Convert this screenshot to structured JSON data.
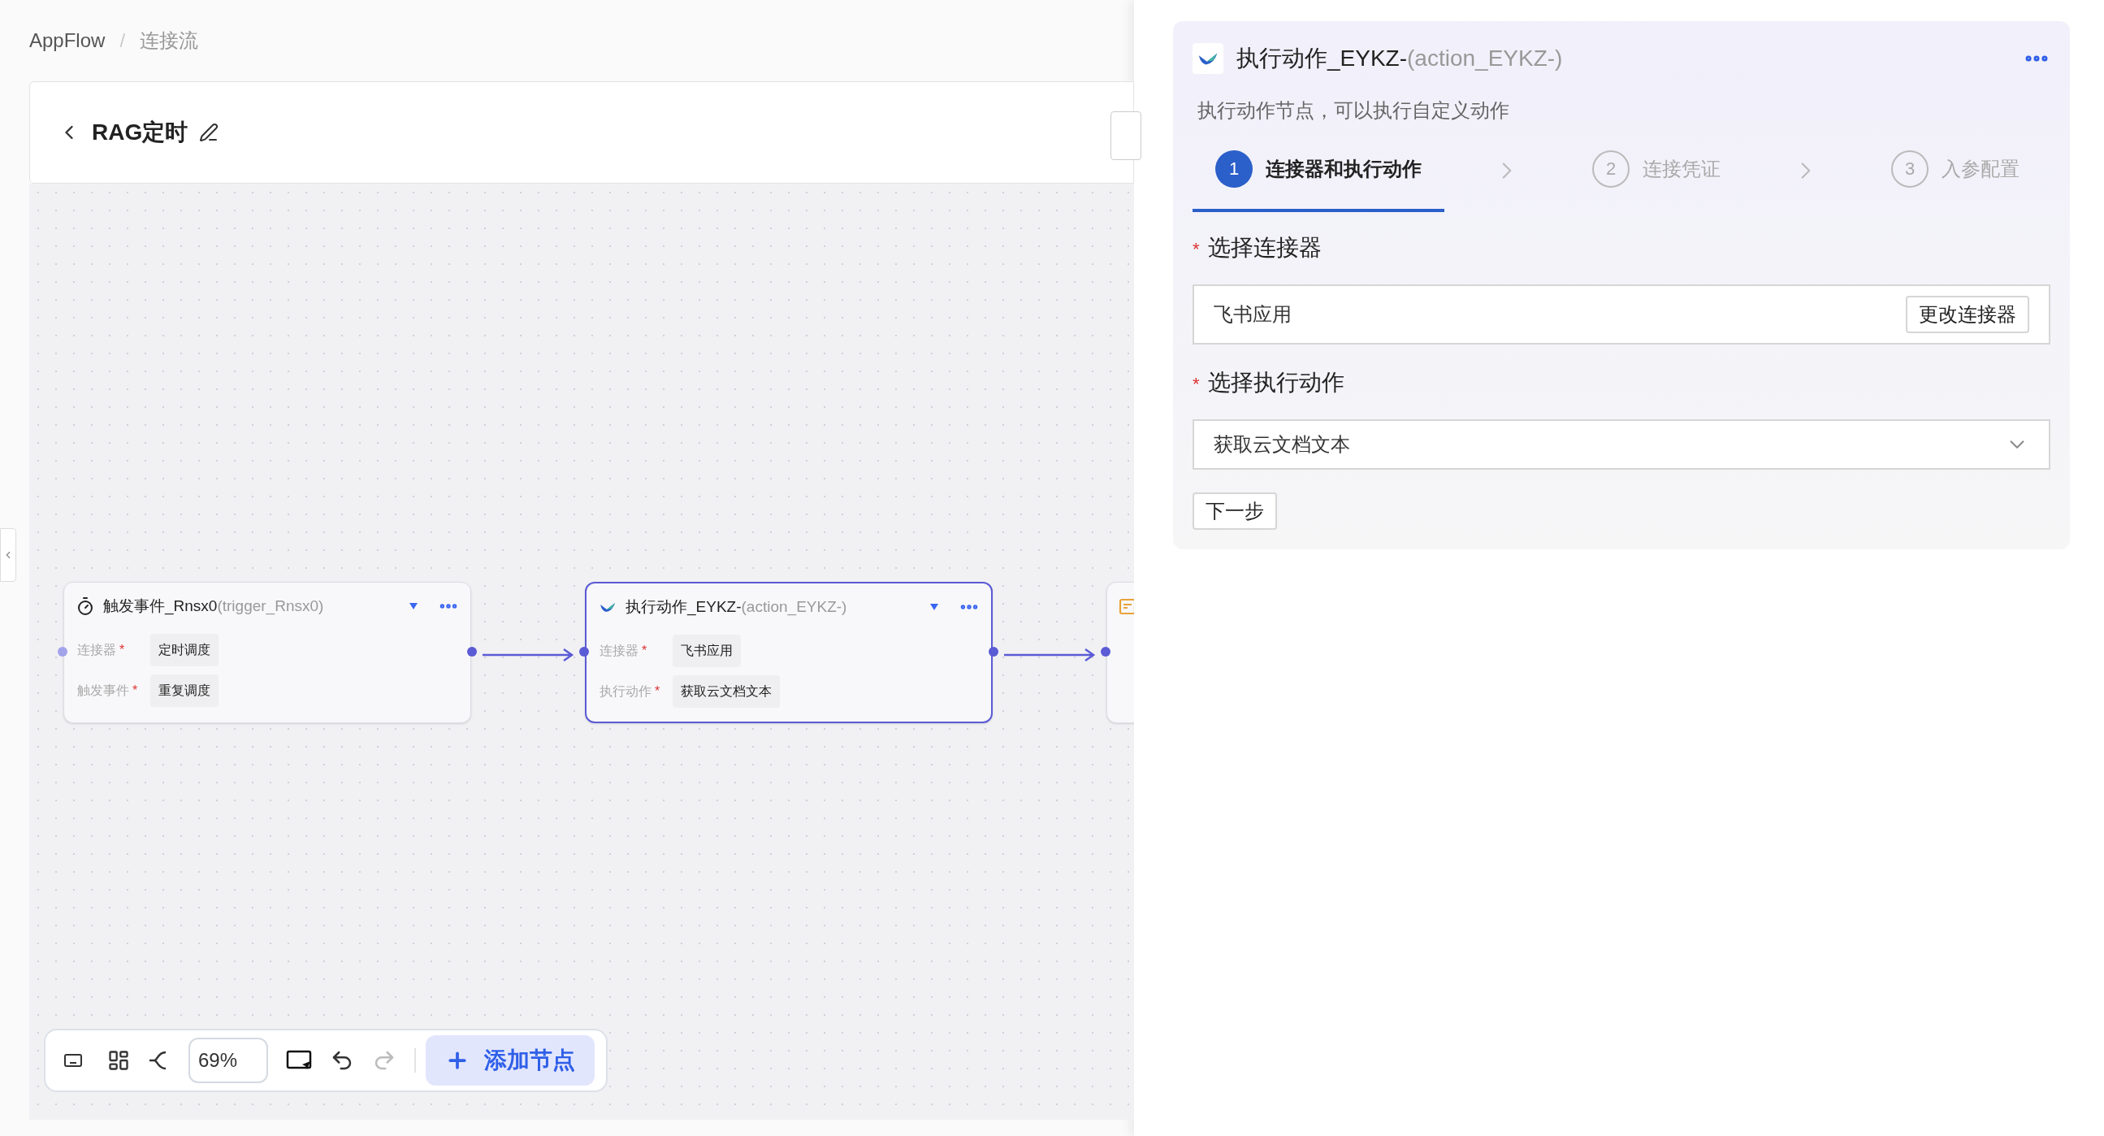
{
  "breadcrumb": [
    {
      "label": "AppFlow"
    },
    {
      "label": "连接流"
    }
  ],
  "breadcrumb_separator": "/",
  "flow": {
    "title": "RAG定时"
  },
  "nodes": [
    {
      "kind": "trigger",
      "title": "触发事件_Rnsx0",
      "id_label": "(trigger_Rnsx0)",
      "selected": false,
      "fields": [
        {
          "label": "连接器",
          "required_mark": "*",
          "value": "定时调度"
        },
        {
          "label": "触发事件",
          "required_mark": "*",
          "value": "重复调度"
        }
      ]
    },
    {
      "kind": "action",
      "title": "执行动作_EYKZ-",
      "id_label": "(action_EYKZ-)",
      "selected": true,
      "fields": [
        {
          "label": "连接器",
          "required_mark": "*",
          "value": "飞书应用"
        },
        {
          "label": "执行动作",
          "required_mark": "*",
          "value": "获取云文档文本"
        }
      ]
    },
    {
      "kind": "partial",
      "selected": false
    }
  ],
  "toolbar": {
    "zoom": "69%",
    "add_node": "添加节点",
    "redo_disabled": true
  },
  "panel": {
    "title": "执行动作_EYKZ-",
    "id_label": "(action_EYKZ-)",
    "description": "执行动作节点，可以执行自定义动作",
    "steps": [
      {
        "number": "1",
        "label": "连接器和执行动作",
        "selected": true
      },
      {
        "number": "2",
        "label": "连接凭证",
        "selected": false
      },
      {
        "number": "3",
        "label": "入参配置",
        "selected": false
      }
    ],
    "connector": {
      "label": "选择连接器",
      "required_mark": "*",
      "value": "飞书应用",
      "button": "更改连接器"
    },
    "action": {
      "label": "选择执行动作",
      "required_mark": "*",
      "value": "获取云文档文本"
    },
    "next": "下一步"
  }
}
